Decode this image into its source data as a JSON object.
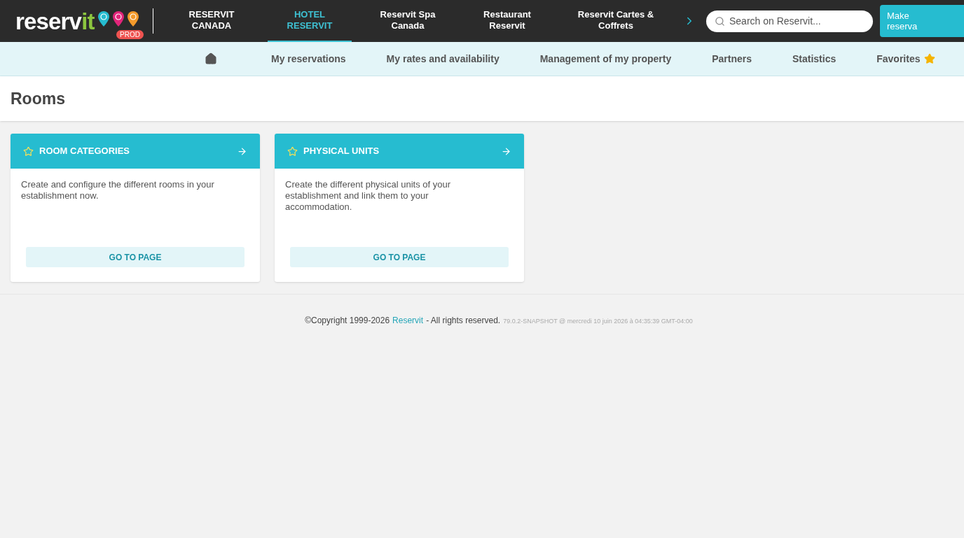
{
  "header": {
    "logo": {
      "part_1": "reserv",
      "part_2": "it",
      "badge": "PROD"
    },
    "tabs": [
      {
        "label": "RESERVIT\nCANADA",
        "selected": false
      },
      {
        "label": "HOTEL\nRESERVIT",
        "selected": true
      },
      {
        "label": "Reservit Spa\nCanada",
        "selected": false
      },
      {
        "label": "Restaurant\nReservit",
        "selected": false
      },
      {
        "label": "Reservit Cartes &\nCoffrets",
        "selected": false
      }
    ],
    "search": {
      "placeholder": "Search on Reservit..."
    },
    "action_button": "Make\nreserva"
  },
  "menu": [
    {
      "kind": "home"
    },
    {
      "kind": "text",
      "label": "My reservations"
    },
    {
      "kind": "text",
      "label": "My rates and availability"
    },
    {
      "kind": "text",
      "label": "Management of my property"
    },
    {
      "kind": "text",
      "label": "Partners"
    },
    {
      "kind": "text",
      "label": "Statistics"
    },
    {
      "kind": "favorites",
      "label": "Favorites"
    }
  ],
  "page_title": "Rooms",
  "cards": [
    {
      "title": "ROOM CATEGORIES",
      "favorite": false,
      "description": "Create and configure the different rooms in your establishment now.",
      "button": "GO TO PAGE"
    },
    {
      "title": "PHYSICAL UNITS",
      "favorite": false,
      "description": "Create the different physical units of your establishment and link them to your accommodation.",
      "button": "GO TO PAGE"
    }
  ],
  "footer": {
    "copyright": "©Copyright 1999-2026",
    "link": "Reservit",
    "rights": "- All rights reserved.",
    "version": "79.0.2-SNAPSHOT @ mercredi 10 juin 2026 à 04:35:39 GMT-04:00"
  }
}
